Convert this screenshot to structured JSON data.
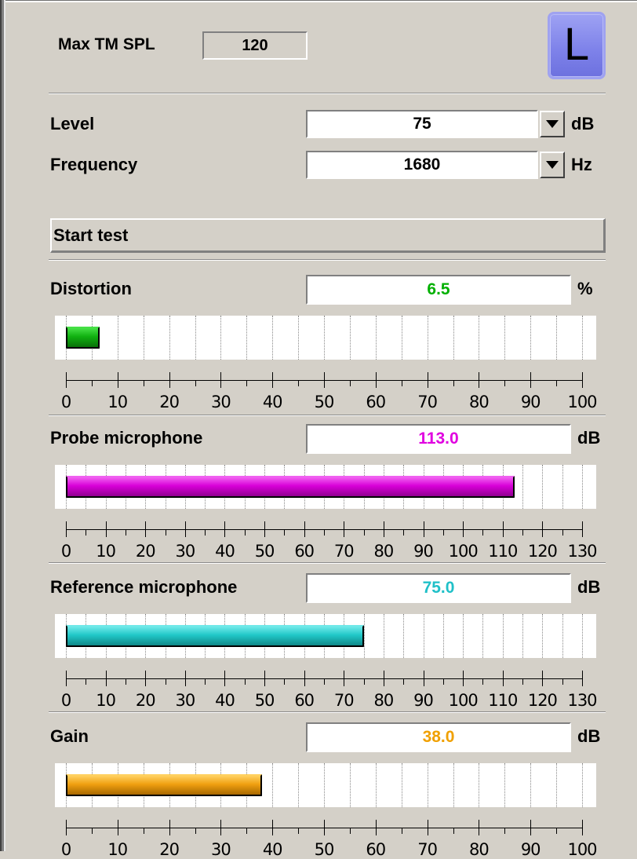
{
  "header": {
    "max_label": "Max TM SPL",
    "max_value": "120",
    "side_button": "L"
  },
  "level": {
    "label": "Level",
    "value": "75",
    "unit": "dB"
  },
  "frequency": {
    "label": "Frequency",
    "value": "1680",
    "unit": "Hz"
  },
  "start_button": "Start test",
  "meters": [
    {
      "key": "distortion",
      "label": "Distortion",
      "value": "6.5",
      "unit": "%",
      "value_color": "#00b000",
      "bar_colors": {
        "base": "#10b010",
        "light": "#45e045",
        "dark": "#087008"
      },
      "scale_max": 100,
      "level": 6.5,
      "ticks": [
        "0",
        "10",
        "20",
        "30",
        "40",
        "50",
        "60",
        "70",
        "80",
        "90",
        "100"
      ]
    },
    {
      "key": "probe",
      "label": "Probe microphone",
      "value": "113.0",
      "unit": "dB",
      "value_color": "#e000e0",
      "bar_colors": {
        "base": "#d800d8",
        "light": "#f060f0",
        "dark": "#900090"
      },
      "scale_max": 130,
      "level": 113.0,
      "ticks": [
        "0",
        "10",
        "20",
        "30",
        "40",
        "50",
        "60",
        "70",
        "80",
        "90",
        "100",
        "110",
        "120",
        "130"
      ]
    },
    {
      "key": "reference",
      "label": "Reference microphone",
      "value": "75.0",
      "unit": "dB",
      "value_color": "#20c0c8",
      "bar_colors": {
        "base": "#20c8c8",
        "light": "#70e8e8",
        "dark": "#108888"
      },
      "scale_max": 130,
      "level": 75.0,
      "ticks": [
        "0",
        "10",
        "20",
        "30",
        "40",
        "50",
        "60",
        "70",
        "80",
        "90",
        "100",
        "110",
        "120",
        "130"
      ]
    },
    {
      "key": "gain",
      "label": "Gain",
      "value": "38.0",
      "unit": "dB",
      "value_color": "#f0a000",
      "bar_colors": {
        "base": "#f0a010",
        "light": "#ffd060",
        "dark": "#a86800"
      },
      "scale_max": 100,
      "level": 38.0,
      "ticks": [
        "0",
        "10",
        "20",
        "30",
        "40",
        "50",
        "60",
        "70",
        "80",
        "90",
        "100"
      ]
    }
  ]
}
